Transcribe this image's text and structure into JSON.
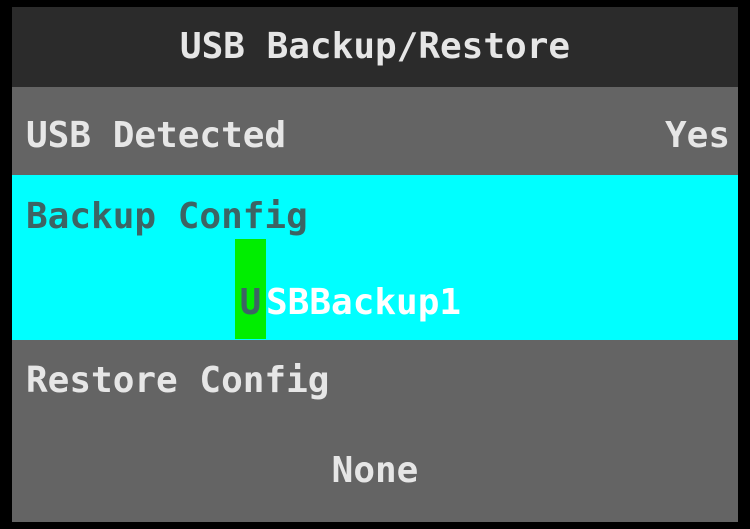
{
  "screen": {
    "title": "USB Backup/Restore"
  },
  "usb_detected": {
    "label": "USB Detected",
    "value": "Yes"
  },
  "backup_config": {
    "label": "Backup Config",
    "filename_cursor_char": "U",
    "filename_rest": "SBBackup1"
  },
  "restore_config": {
    "label": "Restore Config",
    "value": "None"
  },
  "colors": {
    "title_background": "#2b2b2b",
    "screen_background": "#646464",
    "selected_background": "#00ffff",
    "cursor_highlight": "#00ee00",
    "text_light": "#e6e6e6",
    "text_selected": "#3d6464"
  }
}
